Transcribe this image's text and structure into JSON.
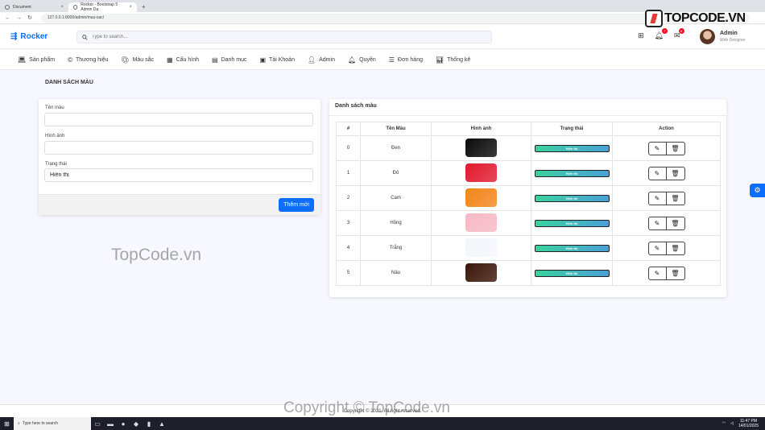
{
  "browser": {
    "tabs": [
      {
        "label": "Document",
        "active": false
      },
      {
        "label": "Rocker - Bootstrap 5 Admin Da",
        "active": true
      }
    ],
    "url": "127.0.0.1:8000/admin/mau-sac/"
  },
  "brand": {
    "name": "Rocker"
  },
  "watermark_logo": {
    "text": "TOPCODE.VN"
  },
  "search": {
    "placeholder": "Type to search..."
  },
  "notifications": {
    "alerts_count": "7",
    "messages_count": "8"
  },
  "user": {
    "name": "Admin",
    "role": "Web Designer"
  },
  "menu": [
    {
      "label": "Sản phẩm",
      "icon": "laptop-icon"
    },
    {
      "label": "Thương hiệu",
      "icon": "copyright-icon"
    },
    {
      "label": "Màu sắc",
      "icon": "palette-icon"
    },
    {
      "label": "Cấu hình",
      "icon": "table-icon"
    },
    {
      "label": "Danh mục",
      "icon": "calendar-icon"
    },
    {
      "label": "Tài Khoản",
      "icon": "id-card-icon"
    },
    {
      "label": "Admin",
      "icon": "person-icon"
    },
    {
      "label": "Quyền",
      "icon": "bell-icon"
    },
    {
      "label": "Đơn hàng",
      "icon": "list-icon"
    },
    {
      "label": "Thống kê",
      "icon": "bar-chart-icon"
    }
  ],
  "page": {
    "title": "DANH SÁCH MÀU"
  },
  "form": {
    "name_label": "Tên màu",
    "name_value": "",
    "image_label": "Hình ảnh",
    "image_value": "",
    "status_label": "Trạng thái",
    "status_value": "Hiển thị",
    "submit_label": "Thêm mới"
  },
  "list": {
    "title": "Danh sách màu",
    "columns": [
      "#",
      "Tên Màu",
      "Hình ảnh",
      "Trạng thái",
      "Action"
    ],
    "rows": [
      {
        "index": "0",
        "name": "Đen",
        "status": "Hiển thị",
        "swatch": "#0a0a0a"
      },
      {
        "index": "1",
        "name": "Đỏ",
        "status": "Hiển thị",
        "swatch": "#e0192e"
      },
      {
        "index": "2",
        "name": "Cam",
        "status": "Hiển thị",
        "swatch": "#f2851a"
      },
      {
        "index": "3",
        "name": "Hồng",
        "status": "Hiển thị",
        "swatch": "#f7b8c4"
      },
      {
        "index": "4",
        "name": "Trắng",
        "status": "Hiển thị",
        "swatch": "#f3f6fb"
      },
      {
        "index": "5",
        "name": "Nâu",
        "status": "Hiển thị",
        "swatch": "#3a1508"
      }
    ]
  },
  "watermarks": {
    "center": "TopCode.vn",
    "bottom": "Copyright © TopCode.vn"
  },
  "footer": {
    "text": "Copyright © 2021. All right reserved."
  },
  "taskbar": {
    "search_placeholder": "Type here to search",
    "time": "11:47 PM",
    "date": "14/01/2025"
  },
  "colors": {
    "primary": "#0d6efd",
    "status_gradient_start": "#3ad29f",
    "status_gradient_end": "#4a9fd8"
  }
}
